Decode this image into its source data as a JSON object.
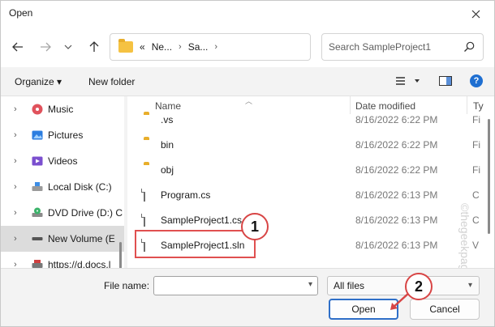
{
  "window": {
    "title": "Open"
  },
  "address": {
    "crumbs": [
      "«",
      "Ne...",
      "Sa..."
    ]
  },
  "search": {
    "placeholder": "Search SampleProject1"
  },
  "toolbar": {
    "organize_label": "Organize ▾",
    "new_folder_label": "New folder"
  },
  "navpane": {
    "items": [
      {
        "label": "Music",
        "icon": "music-icon"
      },
      {
        "label": "Pictures",
        "icon": "pictures-icon"
      },
      {
        "label": "Videos",
        "icon": "videos-icon"
      },
      {
        "label": "Local Disk (C:)",
        "icon": "disk-icon"
      },
      {
        "label": "DVD Drive (D:) C",
        "icon": "dvd-icon"
      },
      {
        "label": "New Volume (E",
        "icon": "drive-icon",
        "selected": true
      },
      {
        "label": "https://d.docs.l",
        "icon": "network-icon"
      }
    ]
  },
  "files": {
    "columns": {
      "name": "Name",
      "date": "Date modified",
      "type": "Ty"
    },
    "rows": [
      {
        "name": ".vs",
        "date": "8/16/2022 6:22 PM",
        "type": "Fi",
        "kind": "folder"
      },
      {
        "name": "bin",
        "date": "8/16/2022 6:22 PM",
        "type": "Fi",
        "kind": "folder"
      },
      {
        "name": "obj",
        "date": "8/16/2022 6:22 PM",
        "type": "Fi",
        "kind": "folder"
      },
      {
        "name": "Program.cs",
        "date": "8/16/2022 6:13 PM",
        "type": "C",
        "kind": "file"
      },
      {
        "name": "SampleProject1.cs",
        "date": "8/16/2022 6:13 PM",
        "type": "C",
        "kind": "file"
      },
      {
        "name": "SampleProject1.sln",
        "date": "8/16/2022 6:13 PM",
        "type": "V",
        "kind": "file"
      }
    ]
  },
  "bottom": {
    "filename_label": "File name:",
    "filename_value": "",
    "filter_value": "All files",
    "open_label": "Open",
    "cancel_label": "Cancel"
  },
  "markers": [
    "1",
    "2"
  ],
  "watermark": "©thegeekpage.com",
  "colors": {
    "accent": "#2f6fc8",
    "highlight": "#e05050",
    "folder": "#f5c242"
  }
}
